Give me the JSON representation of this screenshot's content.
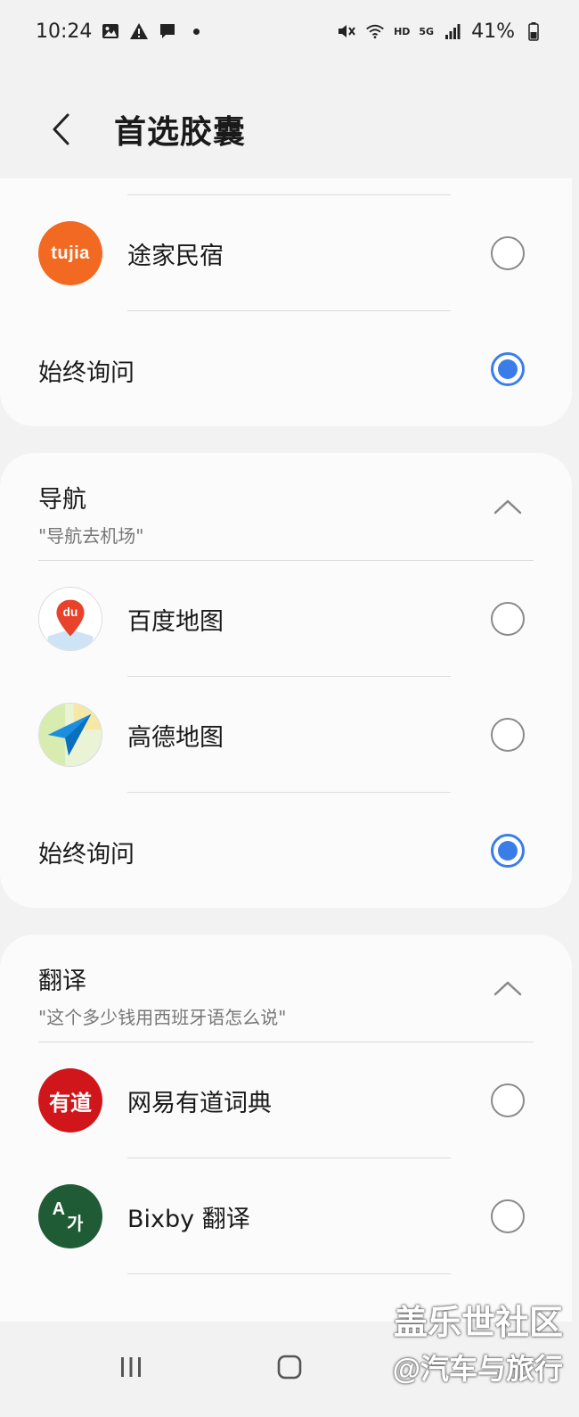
{
  "status_bar": {
    "time": "10:24",
    "hd": "HD",
    "net": "5G",
    "battery": "41%"
  },
  "header": {
    "title": "首选胶囊"
  },
  "top_group": {
    "items": [
      {
        "label": "途家民宿",
        "icon_text": "tujia",
        "selected": false
      }
    ],
    "always_ask": {
      "label": "始终询问",
      "selected": true
    }
  },
  "navigation": {
    "title": "导航",
    "subtitle": "\"导航去机场\"",
    "items": [
      {
        "label": "百度地图",
        "icon_text": "du",
        "selected": false
      },
      {
        "label": "高德地图",
        "selected": false
      }
    ],
    "always_ask": {
      "label": "始终询问",
      "selected": true
    }
  },
  "translation": {
    "title": "翻译",
    "subtitle": "\"这个多少钱用西班牙语怎么说\"",
    "items": [
      {
        "label": "网易有道词典",
        "icon_text": "有道",
        "selected": false
      },
      {
        "label": "Bixby 翻译",
        "icon_text_a": "A",
        "icon_text_b": "가",
        "selected": false
      }
    ]
  },
  "watermark": {
    "line1": "盖乐世社区",
    "line2": "@汽车与旅行"
  },
  "colors": {
    "accent": "#3b7de8",
    "tujia": "#f26a21",
    "youdao": "#d1161b",
    "bixby": "#1f5c35"
  }
}
